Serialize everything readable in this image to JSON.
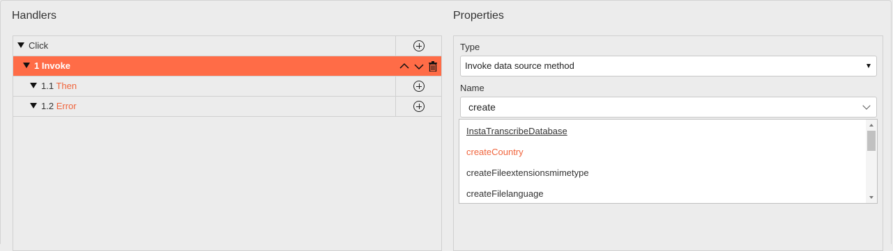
{
  "handlers": {
    "title": "Handlers",
    "tree": [
      {
        "label": "Click",
        "sub": "",
        "selected": false
      },
      {
        "label": "1 Invoke",
        "sub": "",
        "selected": true
      },
      {
        "label": "1.1 ",
        "sub": "Then",
        "selected": false
      },
      {
        "label": "1.2 ",
        "sub": "Error",
        "selected": false
      }
    ],
    "icons": {
      "add": "plus-circle-icon",
      "up": "chevron-up-icon",
      "down": "chevron-down-icon",
      "delete": "trash-icon"
    }
  },
  "properties": {
    "title": "Properties",
    "type_label": "Type",
    "type_value": "Invoke data source method",
    "name_label": "Name",
    "name_value": "create",
    "options": [
      "InstaTranscribeDatabase",
      "createCountry",
      "createFileextensionsmimetype",
      "createFilelanguage"
    ]
  },
  "colors": {
    "accent": "#ff6c47",
    "accent_text": "#f0643c"
  }
}
